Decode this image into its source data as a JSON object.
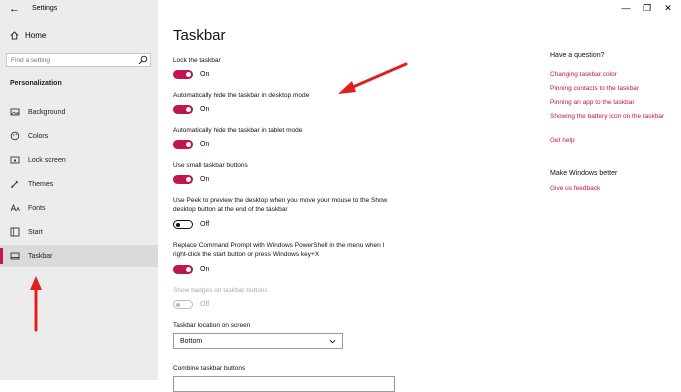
{
  "window": {
    "title": "Settings",
    "back_symbol": "←",
    "minimize_symbol": "—",
    "maximize_symbol": "❐",
    "close_symbol": "✕"
  },
  "sidebar": {
    "home_label": "Home",
    "search_placeholder": "Find a setting",
    "section_heading": "Personalization",
    "items": [
      {
        "label": "Background",
        "icon": "picture-icon"
      },
      {
        "label": "Colors",
        "icon": "palette-icon"
      },
      {
        "label": "Lock screen",
        "icon": "lock-screen-icon"
      },
      {
        "label": "Themes",
        "icon": "brush-icon"
      },
      {
        "label": "Fonts",
        "icon": "font-icon"
      },
      {
        "label": "Start",
        "icon": "start-icon"
      },
      {
        "label": "Taskbar",
        "icon": "taskbar-icon",
        "active": true
      }
    ]
  },
  "main": {
    "title": "Taskbar",
    "settings": [
      {
        "label": "Lock the taskbar",
        "state": "On"
      },
      {
        "label": "Automatically hide the taskbar in desktop mode",
        "state": "On"
      },
      {
        "label": "Automatically hide the taskbar in tablet mode",
        "state": "On"
      },
      {
        "label": "Use small taskbar buttons",
        "state": "On"
      },
      {
        "label": "Use Peek to preview the desktop when you move your mouse to the Show desktop button at the end of the taskbar",
        "state": "Off"
      },
      {
        "label": "Replace Command Prompt with Windows PowerShell in the menu when I right-click the start button or press Windows key+X",
        "state": "On"
      },
      {
        "label": "Show badges on taskbar buttons",
        "state": "Off",
        "disabled": true
      }
    ],
    "location_label": "Taskbar location on screen",
    "location_value": "Bottom",
    "combine_label": "Combine taskbar buttons"
  },
  "help": {
    "question_heading": "Have a question?",
    "links": [
      "Changing taskbar color",
      "Pinning contacts to the taskbar",
      "Pinning an app to the taskbar",
      "Showing the battery icon on the taskbar",
      "Get help"
    ],
    "better_heading": "Make Windows better",
    "feedback_link": "Give us feedback"
  },
  "colors": {
    "accent": "#c0154f",
    "annotation_arrow": "#e02020",
    "sidebar_bg": "#ececec"
  }
}
